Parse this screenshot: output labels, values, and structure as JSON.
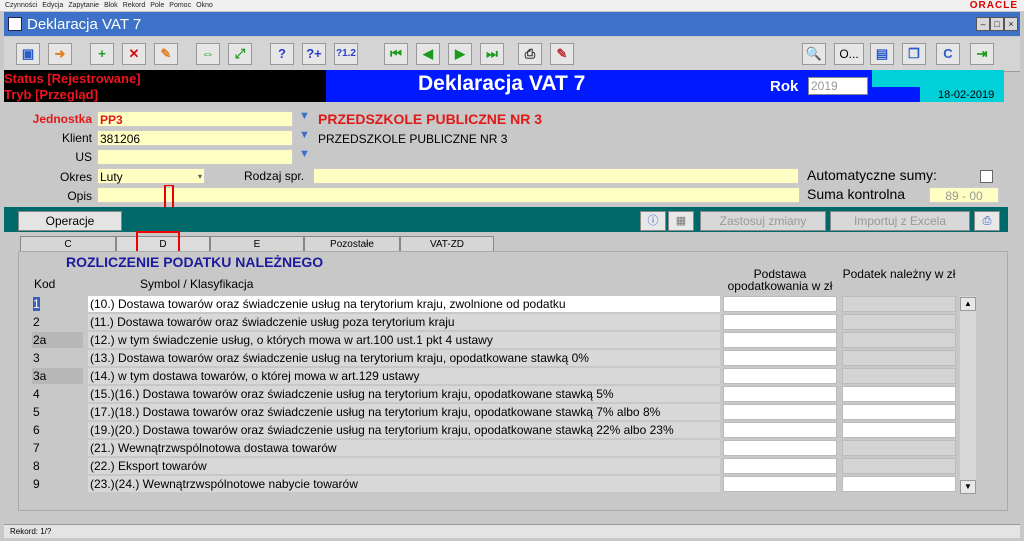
{
  "menu": [
    "Czynności",
    "Edycja",
    "Zapytanie",
    "Blok",
    "Rekord",
    "Pole",
    "Pomoc",
    "Okno"
  ],
  "oracle_logo": "ORACLE",
  "window": {
    "title": "Deklaracja VAT 7"
  },
  "header": {
    "status1": "Status [Rejestrowane]",
    "status2": "Tryb [Przegląd]",
    "title": "Deklaracja VAT 7",
    "rok_label": "Rok",
    "rok_value": "2019",
    "date": "18-02-2019"
  },
  "form": {
    "jednostka_label": "Jednostka",
    "jednostka_value": "PP3",
    "jednostka_name": "PRZEDSZKOLE PUBLICZNE NR 3",
    "klient_label": "Klient",
    "klient_value": "381206",
    "klient_name": "PRZEDSZKOLE PUBLICZNE NR 3",
    "us_label": "US",
    "us_value": "",
    "okres_label": "Okres",
    "okres_value": "Luty",
    "rodzaj_label": "Rodzaj spr.",
    "rodzaj_value": "",
    "auto_label": "Automatyczne sumy:",
    "opis_label": "Opis",
    "opis_value": "",
    "suma_label": "Suma kontrolna",
    "suma_value": "89 - 00"
  },
  "ops": {
    "operacje": "Operacje",
    "zastosuj": "Zastosuj zmiany",
    "importuj": "Importuj z Excela"
  },
  "tabs": [
    "C",
    "D",
    "E",
    "Pozostałe",
    "VAT-ZD"
  ],
  "section": {
    "title": "ROZLICZENIE PODATKU NALEŻNEGO",
    "col_kod": "Kod",
    "col_symbol": "Symbol / Klasyfikacja",
    "col_podstawa": "Podstawa opodatkowania w zł",
    "col_podatek": "Podatek należny w zł"
  },
  "rows": [
    {
      "kod": "1",
      "desc": "(10.) Dostawa towarów oraz świadczenie usług na terytorium kraju, zwolnione od podatku"
    },
    {
      "kod": "2",
      "desc": "(11.) Dostawa towarów oraz świadczenie usług poza terytorium kraju"
    },
    {
      "kod": "2a",
      "desc": "(12.) w tym świadczenie usług, o których mowa w art.100 ust.1 pkt 4 ustawy"
    },
    {
      "kod": "3",
      "desc": "(13.) Dostawa towarów oraz świadczenie usług na terytorium kraju, opodatkowane stawką 0%"
    },
    {
      "kod": "3a",
      "desc": "(14.) w tym dostawa towarów, o której mowa w art.129 ustawy"
    },
    {
      "kod": "4",
      "desc": "(15.)(16.) Dostawa towarów oraz świadczenie usług na terytorium kraju, opodatkowane stawką 5%"
    },
    {
      "kod": "5",
      "desc": "(17.)(18.) Dostawa towarów oraz świadczenie usług na terytorium kraju, opodatkowane stawką 7% albo 8%"
    },
    {
      "kod": "6",
      "desc": "(19.)(20.) Dostawa towarów oraz świadczenie usług na terytorium kraju, opodatkowane stawką 22% albo 23%"
    },
    {
      "kod": "7",
      "desc": "(21.) Wewnątrzwspólnotowa dostawa towarów"
    },
    {
      "kod": "8",
      "desc": "(22.) Eksport towarów"
    },
    {
      "kod": "9",
      "desc": "(23.)(24.) Wewnątrzwspólnotowe nabycie towarów"
    }
  ],
  "statusline": "Rekord: 1/?",
  "toolbar_o_label": "O...",
  "colors": {
    "title_blue": "#0019ff",
    "teal": "#006a6a",
    "status_red": "#f0141e",
    "field_yellow": "#ffffc4"
  }
}
